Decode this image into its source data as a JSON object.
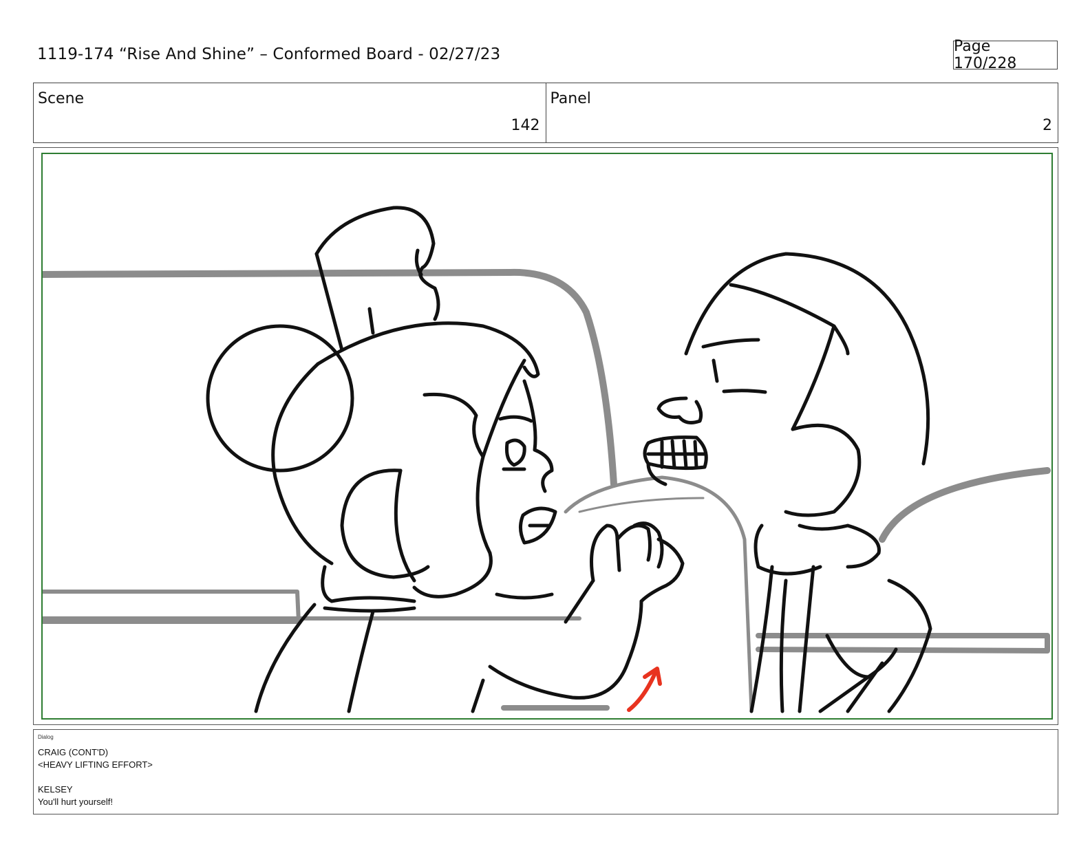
{
  "header": {
    "title": "1119-174 “Rise And Shine” – Conformed Board - 02/27/23",
    "page": "Page 170/228"
  },
  "info": {
    "scene_label": "Scene",
    "scene_value": "142",
    "panel_label": "Panel",
    "panel_value": "2"
  },
  "frame": {
    "description_icon": "storyboard-drawing",
    "safe_area_color": "#2e7d32",
    "arrow_color": "#e8331f"
  },
  "dialog": {
    "tag": "Dialog",
    "lines": [
      "CRAIG (CONT'D)",
      "<HEAVY LIFTING EFFORT>",
      "",
      "KELSEY",
      "You'll hurt yourself!"
    ]
  }
}
